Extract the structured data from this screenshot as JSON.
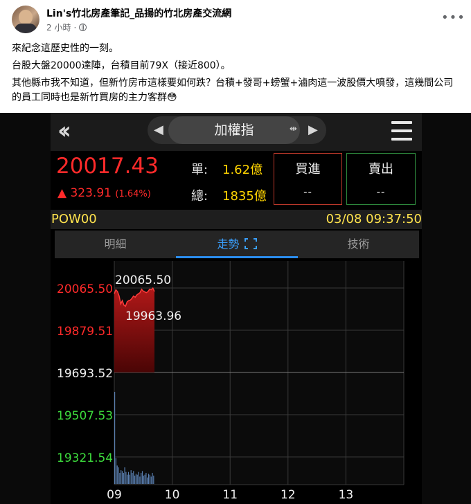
{
  "post": {
    "author": "Lin's竹北房產筆記_品揚的竹北房產交流網",
    "time": "2 小時",
    "privacy_icon": "globe-icon",
    "more_icon": "ellipsis-icon",
    "paragraphs": [
      "來紀念這歷史性的一刻。",
      "台股大盤20000達陣，台積目前79X（接近800）。",
      "其他縣市我不知道，但新竹房市這樣要如何跌？台積+發哥+螃蟹+滷肉這一波股價大噴發，這幾間公司的員工同時也是新竹買房的主力客群😳"
    ]
  },
  "app": {
    "title": "加權指",
    "price": "20017.43",
    "change": "▲ 323.91",
    "change_pct": "(1.64%)",
    "single_label": "單:",
    "single_value": "1.62億",
    "total_label": "總:",
    "total_value": "1835億",
    "buy_label": "買進",
    "buy_value": "--",
    "sell_label": "賣出",
    "sell_value": "--",
    "symbol": "POW00",
    "datetime": "03/08 09:37:50",
    "tabs": [
      {
        "label": "明細",
        "active": false
      },
      {
        "label": "走勢",
        "active": true
      },
      {
        "label": "技術",
        "active": false
      }
    ],
    "colors": {
      "up": "#ff2a2a",
      "down": "#3ddc3d",
      "accent": "#3aa0ff",
      "info": "#ffe34d"
    }
  },
  "chart_data": {
    "type": "area",
    "y_ticks": [
      {
        "value": 20065.5,
        "label": "20065.50",
        "color": "#ff2a2a"
      },
      {
        "value": 19879.51,
        "label": "19879.51",
        "color": "#ff2a2a"
      },
      {
        "value": 19693.52,
        "label": "19693.52",
        "color": "#f0f0f0"
      },
      {
        "value": 19507.53,
        "label": "19507.53",
        "color": "#3ddc3d"
      },
      {
        "value": 19321.54,
        "label": "19321.54",
        "color": "#3ddc3d"
      }
    ],
    "x_ticks": [
      "09",
      "10",
      "11",
      "12",
      "13"
    ],
    "reference": 19693.52,
    "high_label": "20065.50",
    "low_label": "19963.96",
    "price_series": [
      20040,
      20058,
      20050,
      20030,
      19995,
      20010,
      19990,
      19985,
      20005,
      20010,
      20012,
      20020,
      20030,
      20025,
      20035,
      20040,
      20045,
      20060,
      20052,
      20048,
      20045,
      20050,
      20060,
      20058,
      20065,
      20050
    ],
    "volume_series": [
      100,
      28,
      20,
      18,
      12,
      15,
      14,
      12,
      18,
      13,
      10,
      13,
      10,
      15,
      12,
      14,
      9,
      11,
      10,
      13,
      8,
      12,
      14,
      9,
      10,
      12,
      7,
      11,
      10,
      8,
      12,
      9
    ]
  }
}
